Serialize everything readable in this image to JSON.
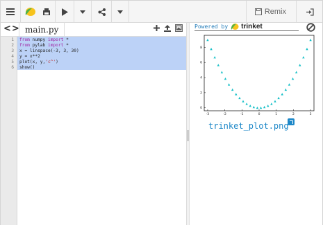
{
  "toolbar": {
    "menu_icon": "hamburger-menu-icon",
    "logo_icon": "trinket-logo-icon",
    "remix_label": "Remix"
  },
  "editor": {
    "tab_name": "main.py",
    "lines": [
      {
        "num": "1",
        "text": "from numpy import *"
      },
      {
        "num": "2",
        "text": "from pylab import *"
      },
      {
        "num": "3",
        "text": "x = linspace(-3, 3, 30)"
      },
      {
        "num": "4",
        "text": "y = x**2"
      },
      {
        "num": "5",
        "text": "plot(x, y,'c^')"
      },
      {
        "num": "6",
        "text": "show()"
      }
    ]
  },
  "output": {
    "powered_by": "Powered by",
    "brand": "trinket",
    "plot_filename": "trinket_plot.png"
  },
  "chart_data": {
    "type": "scatter",
    "marker": "triangle",
    "color": "#18c0c8",
    "x": [
      -3.0,
      -2.793,
      -2.586,
      -2.379,
      -2.172,
      -1.966,
      -1.759,
      -1.552,
      -1.345,
      -1.138,
      -0.931,
      -0.724,
      -0.517,
      -0.31,
      -0.103,
      0.103,
      0.31,
      0.517,
      0.724,
      0.931,
      1.138,
      1.345,
      1.552,
      1.759,
      1.966,
      2.172,
      2.379,
      2.586,
      2.793,
      3.0
    ],
    "y": [
      9.0,
      7.8,
      6.69,
      5.66,
      4.72,
      3.86,
      3.09,
      2.41,
      1.81,
      1.3,
      0.87,
      0.52,
      0.27,
      0.1,
      0.01,
      0.01,
      0.1,
      0.27,
      0.52,
      0.87,
      1.3,
      1.81,
      2.41,
      3.09,
      3.86,
      4.72,
      5.66,
      6.69,
      7.8,
      9.0
    ],
    "xlim": [
      -3.2,
      3.2
    ],
    "ylim": [
      -0.4,
      9.6
    ],
    "xticks": [
      "-3",
      "-2",
      "-1",
      "0",
      "1",
      "2",
      "3"
    ],
    "yticks": [
      "0",
      "2",
      "4",
      "6",
      "8"
    ],
    "title": "",
    "xlabel": "",
    "ylabel": ""
  }
}
